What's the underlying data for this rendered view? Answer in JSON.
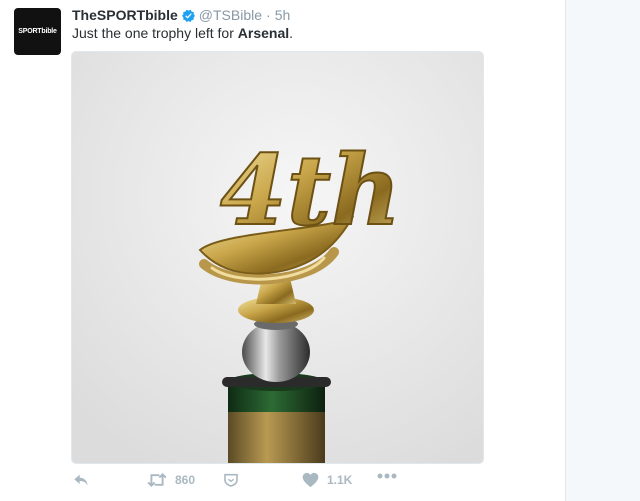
{
  "tweet": {
    "display_name": "TheSPORTbible",
    "handle": "@TSBible",
    "separator": "·",
    "time": "5h",
    "avatar_text": "SPORTbible",
    "text_before": "Just the one trophy left for ",
    "text_bold": "Arsenal",
    "text_after": ".",
    "media": {
      "subject": "gold-4th-place-trophy-icon",
      "engraving": "4th"
    }
  },
  "actions": {
    "retweet_count": "860",
    "like_count": "1.1K"
  },
  "colors": {
    "accent": "#1da1f2",
    "text": "#292f33",
    "muted": "#8899a6",
    "action_gray": "#aab8c2"
  }
}
